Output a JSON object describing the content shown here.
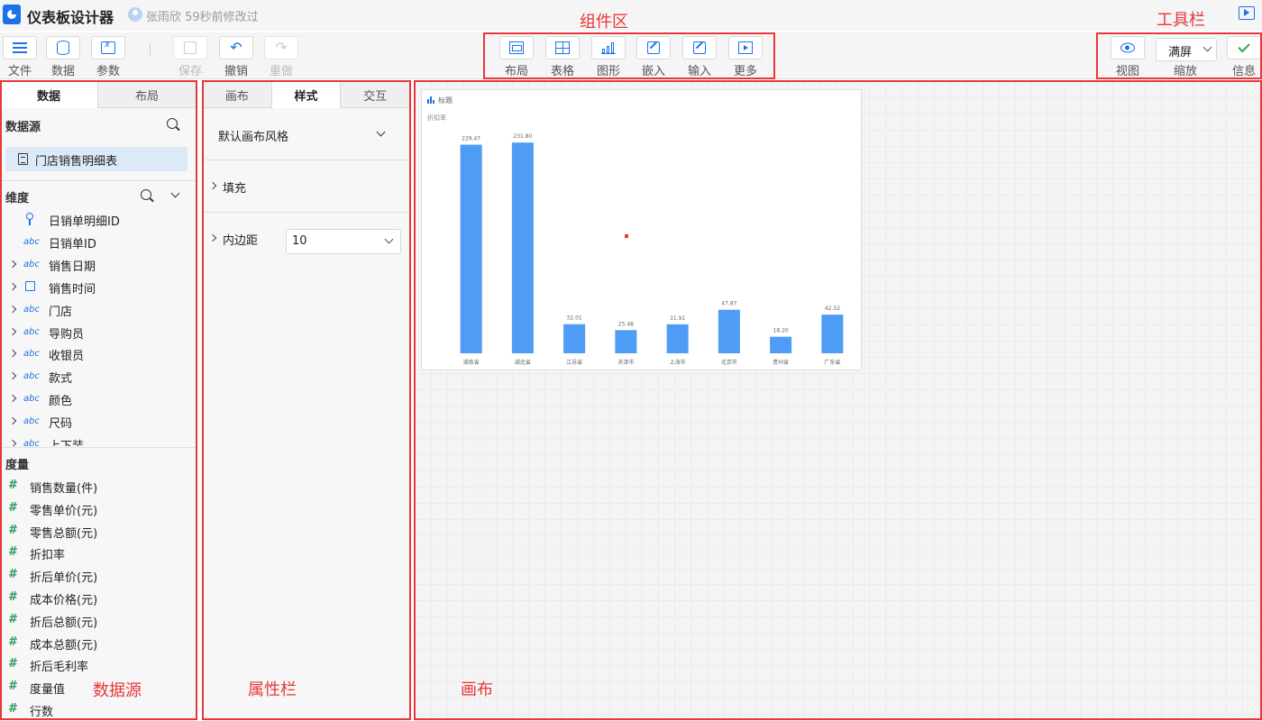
{
  "app": {
    "title": "仪表板设计器",
    "user_status": "张雨欣 59秒前修改过"
  },
  "toolbar": {
    "file": "文件",
    "data": "数据",
    "params": "参数",
    "save": "保存",
    "undo": "撤销",
    "redo": "重做",
    "components": [
      "布局",
      "表格",
      "图形",
      "嵌入",
      "输入",
      "更多"
    ],
    "view": "视图",
    "zoom_value": "满屏",
    "zoom_label": "缩放",
    "info": "信息"
  },
  "annotations": {
    "component_area": "组件区",
    "toolbar_area": "工具栏",
    "datasource_area": "数据源",
    "property_area": "属性栏",
    "canvas_area": "画布"
  },
  "data_panel": {
    "tabs": [
      "数据",
      "布局"
    ],
    "active_tab": "数据",
    "datasource_title": "数据源",
    "datasource_item": "门店销售明细表",
    "dimension_title": "维度",
    "dimensions": [
      {
        "type": "key",
        "expandable": false,
        "name": "日销单明细ID"
      },
      {
        "type": "abc",
        "expandable": false,
        "name": "日销单ID"
      },
      {
        "type": "abc",
        "expandable": true,
        "name": "销售日期"
      },
      {
        "type": "cal",
        "expandable": true,
        "name": "销售时间"
      },
      {
        "type": "abc",
        "expandable": true,
        "name": "门店"
      },
      {
        "type": "abc",
        "expandable": true,
        "name": "导购员"
      },
      {
        "type": "abc",
        "expandable": true,
        "name": "收银员"
      },
      {
        "type": "abc",
        "expandable": true,
        "name": "款式"
      },
      {
        "type": "abc",
        "expandable": true,
        "name": "颜色"
      },
      {
        "type": "abc",
        "expandable": true,
        "name": "尺码"
      },
      {
        "type": "abc",
        "expandable": true,
        "name": "上下装"
      }
    ],
    "measure_title": "度量",
    "measures": [
      "销售数量(件)",
      "零售单价(元)",
      "零售总额(元)",
      "折扣率",
      "折后单价(元)",
      "成本价格(元)",
      "折后总额(元)",
      "成本总额(元)",
      "折后毛利率",
      "度量值",
      "行数"
    ]
  },
  "prop_panel": {
    "tabs": [
      "画布",
      "样式",
      "交互"
    ],
    "active_tab": "样式",
    "canvas_style": "默认画布风格",
    "fill": "填充",
    "padding_label": "内边距",
    "padding_value": "10"
  },
  "chart_data": {
    "type": "bar",
    "title": "标题",
    "ylabel": "折扣率",
    "categories": [
      "湖南省",
      "湖北省",
      "江苏省",
      "天津市",
      "上海市",
      "北京市",
      "贵州省",
      "广东省"
    ],
    "values": [
      229.47,
      231.8,
      32.01,
      25.48,
      31.91,
      47.87,
      18.2,
      42.52
    ],
    "value_labels": [
      "229.47",
      "231.80",
      "32.01",
      "25.48",
      "31.91",
      "47.87",
      "18.20",
      "42.52"
    ],
    "ylim": [
      0,
      232
    ],
    "bar_color": "#4e9cf5",
    "grid": false,
    "legend": "none"
  }
}
